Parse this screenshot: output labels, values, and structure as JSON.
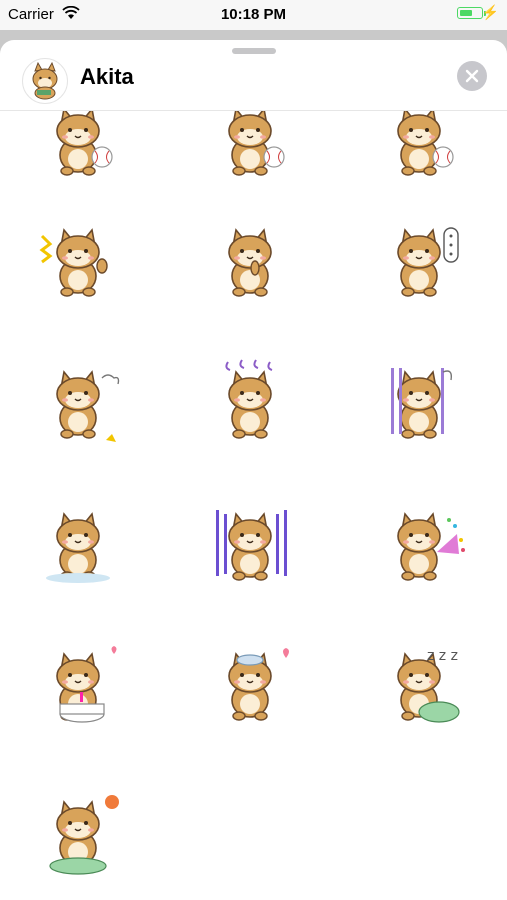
{
  "status": {
    "carrier": "Carrier",
    "time": "10:18 PM",
    "battery_level": 0.6
  },
  "header": {
    "title": "Akita",
    "close_icon": "close-icon"
  },
  "stickers": [
    "baseball",
    "baseball",
    "baseball",
    "waving",
    "thinking",
    "ellipsis-bubble",
    "frustrated",
    "gloomy",
    "shocked",
    "shy",
    "shivering",
    "party-popper",
    "birthday-cake",
    "bath-heart",
    "sleeping",
    "waking-up"
  ],
  "colors": {
    "accent_fur": "#d8a35a",
    "outline": "#6b4a2b",
    "close_bg": "#c7c7cc",
    "battery": "#4cd964"
  }
}
